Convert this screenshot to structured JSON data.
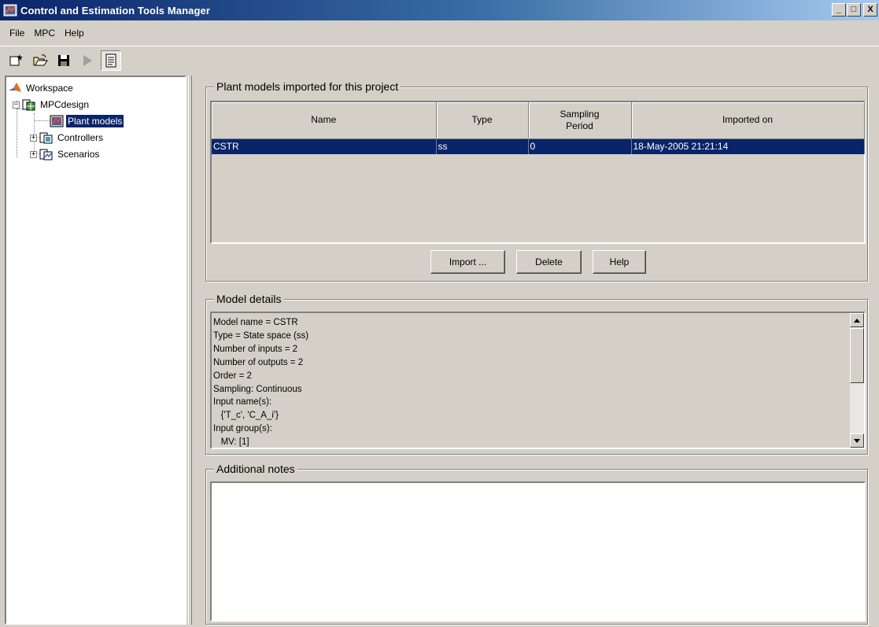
{
  "window": {
    "title": "Control and Estimation Tools Manager",
    "minimize_label": "_",
    "maximize_label": "□",
    "close_label": "X"
  },
  "menu": [
    {
      "label": "File"
    },
    {
      "label": "MPC"
    },
    {
      "label": "Help"
    }
  ],
  "toolbar": {
    "icons": [
      "new-project-icon",
      "open-folder-icon",
      "save-disk-icon",
      "run-play-icon",
      "notes-view-icon"
    ]
  },
  "tree": {
    "workspace": "Workspace",
    "project": "MPCdesign",
    "plant_models": "Plant models",
    "controllers": "Controllers",
    "scenarios": "Scenarios",
    "expanded_symbol": "−",
    "collapsed_symbol": "+"
  },
  "plant_models_panel": {
    "title": "Plant models imported for this project",
    "columns": [
      "Name",
      "Type",
      "Sampling Period",
      "Imported on"
    ],
    "rows": [
      {
        "name": "CSTR",
        "type": "ss",
        "sampling_period": "0",
        "imported_on": "18-May-2005 21:21:14",
        "selected": true
      }
    ],
    "buttons": {
      "import": "Import ...",
      "delete": "Delete",
      "help": "Help"
    }
  },
  "model_details": {
    "title": "Model details",
    "lines": [
      "Model name = CSTR",
      "Type = State space (ss)",
      "Number of inputs = 2",
      "Number of outputs = 2",
      "Order = 2",
      "Sampling: Continuous",
      "Input name(s):",
      "   {'T_c', 'C_A_i'}",
      "Input group(s):",
      "   MV: [1]"
    ]
  },
  "additional_notes": {
    "title": "Additional notes",
    "value": ""
  },
  "colors": {
    "selection": "#0a246a",
    "face": "#d4d0c8",
    "title_gradient_start": "#0a246a",
    "title_gradient_end": "#a6caf0"
  }
}
